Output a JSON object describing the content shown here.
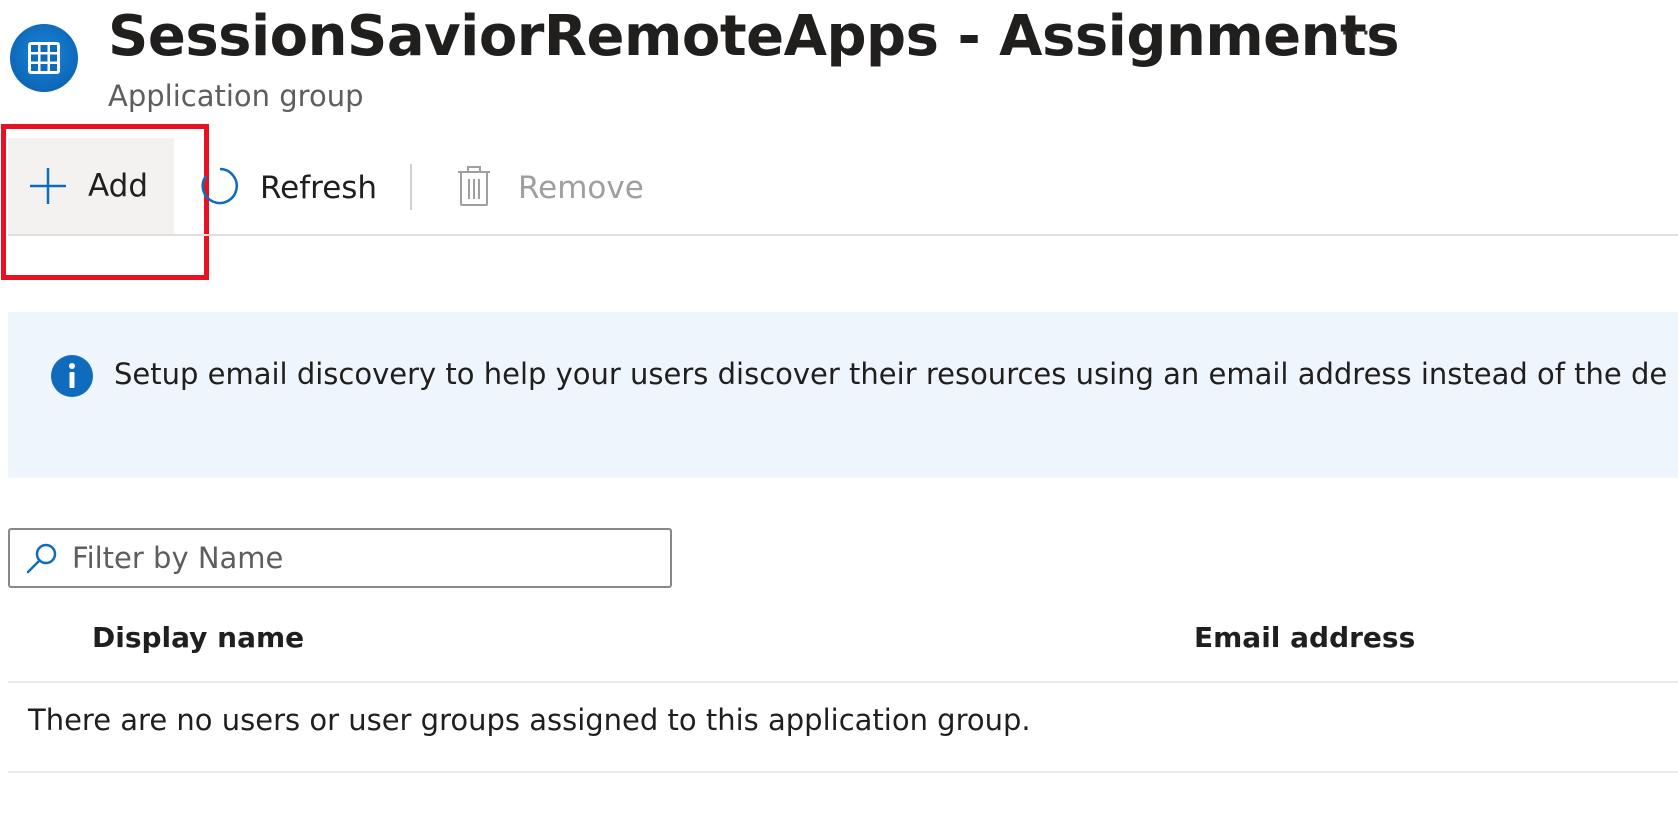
{
  "header": {
    "title": "SessionSaviorRemoteApps - Assignments",
    "subtitle": "Application group",
    "more_label": "···",
    "icon": "app-group-grid-icon"
  },
  "toolbar": {
    "add_label": "Add",
    "refresh_label": "Refresh",
    "remove_label": "Remove",
    "icons": {
      "add": "plus-icon",
      "refresh": "refresh-icon",
      "remove": "trash-icon"
    }
  },
  "banner": {
    "text": "Setup email discovery to help your users discover their resources using an email address instead of the de",
    "icon": "info-icon"
  },
  "filter": {
    "placeholder": "Filter by Name",
    "value": "",
    "icon": "search-icon"
  },
  "table": {
    "columns": [
      "Display name",
      "Email address"
    ],
    "empty_message": "There are no users or user groups assigned to this application group."
  },
  "colors": {
    "accent": "#0f6cbd",
    "highlight": "#e81123",
    "banner_bg": "#eff5fd",
    "disabled_text": "#a19f9d"
  }
}
